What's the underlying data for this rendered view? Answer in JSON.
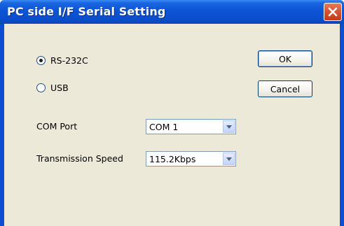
{
  "window": {
    "title": "PC side I/F Serial Setting"
  },
  "interface": {
    "options": [
      {
        "label": "RS-232C",
        "selected": true
      },
      {
        "label": "USB",
        "selected": false
      }
    ]
  },
  "buttons": {
    "ok": "OK",
    "cancel": "Cancel"
  },
  "com_port": {
    "label": "COM Port",
    "value": "COM 1"
  },
  "transmission_speed": {
    "label": "Transmission Speed",
    "value": "115.2Kbps"
  },
  "icons": {
    "close": "close-icon",
    "dropdown": "chevron-down-icon"
  }
}
